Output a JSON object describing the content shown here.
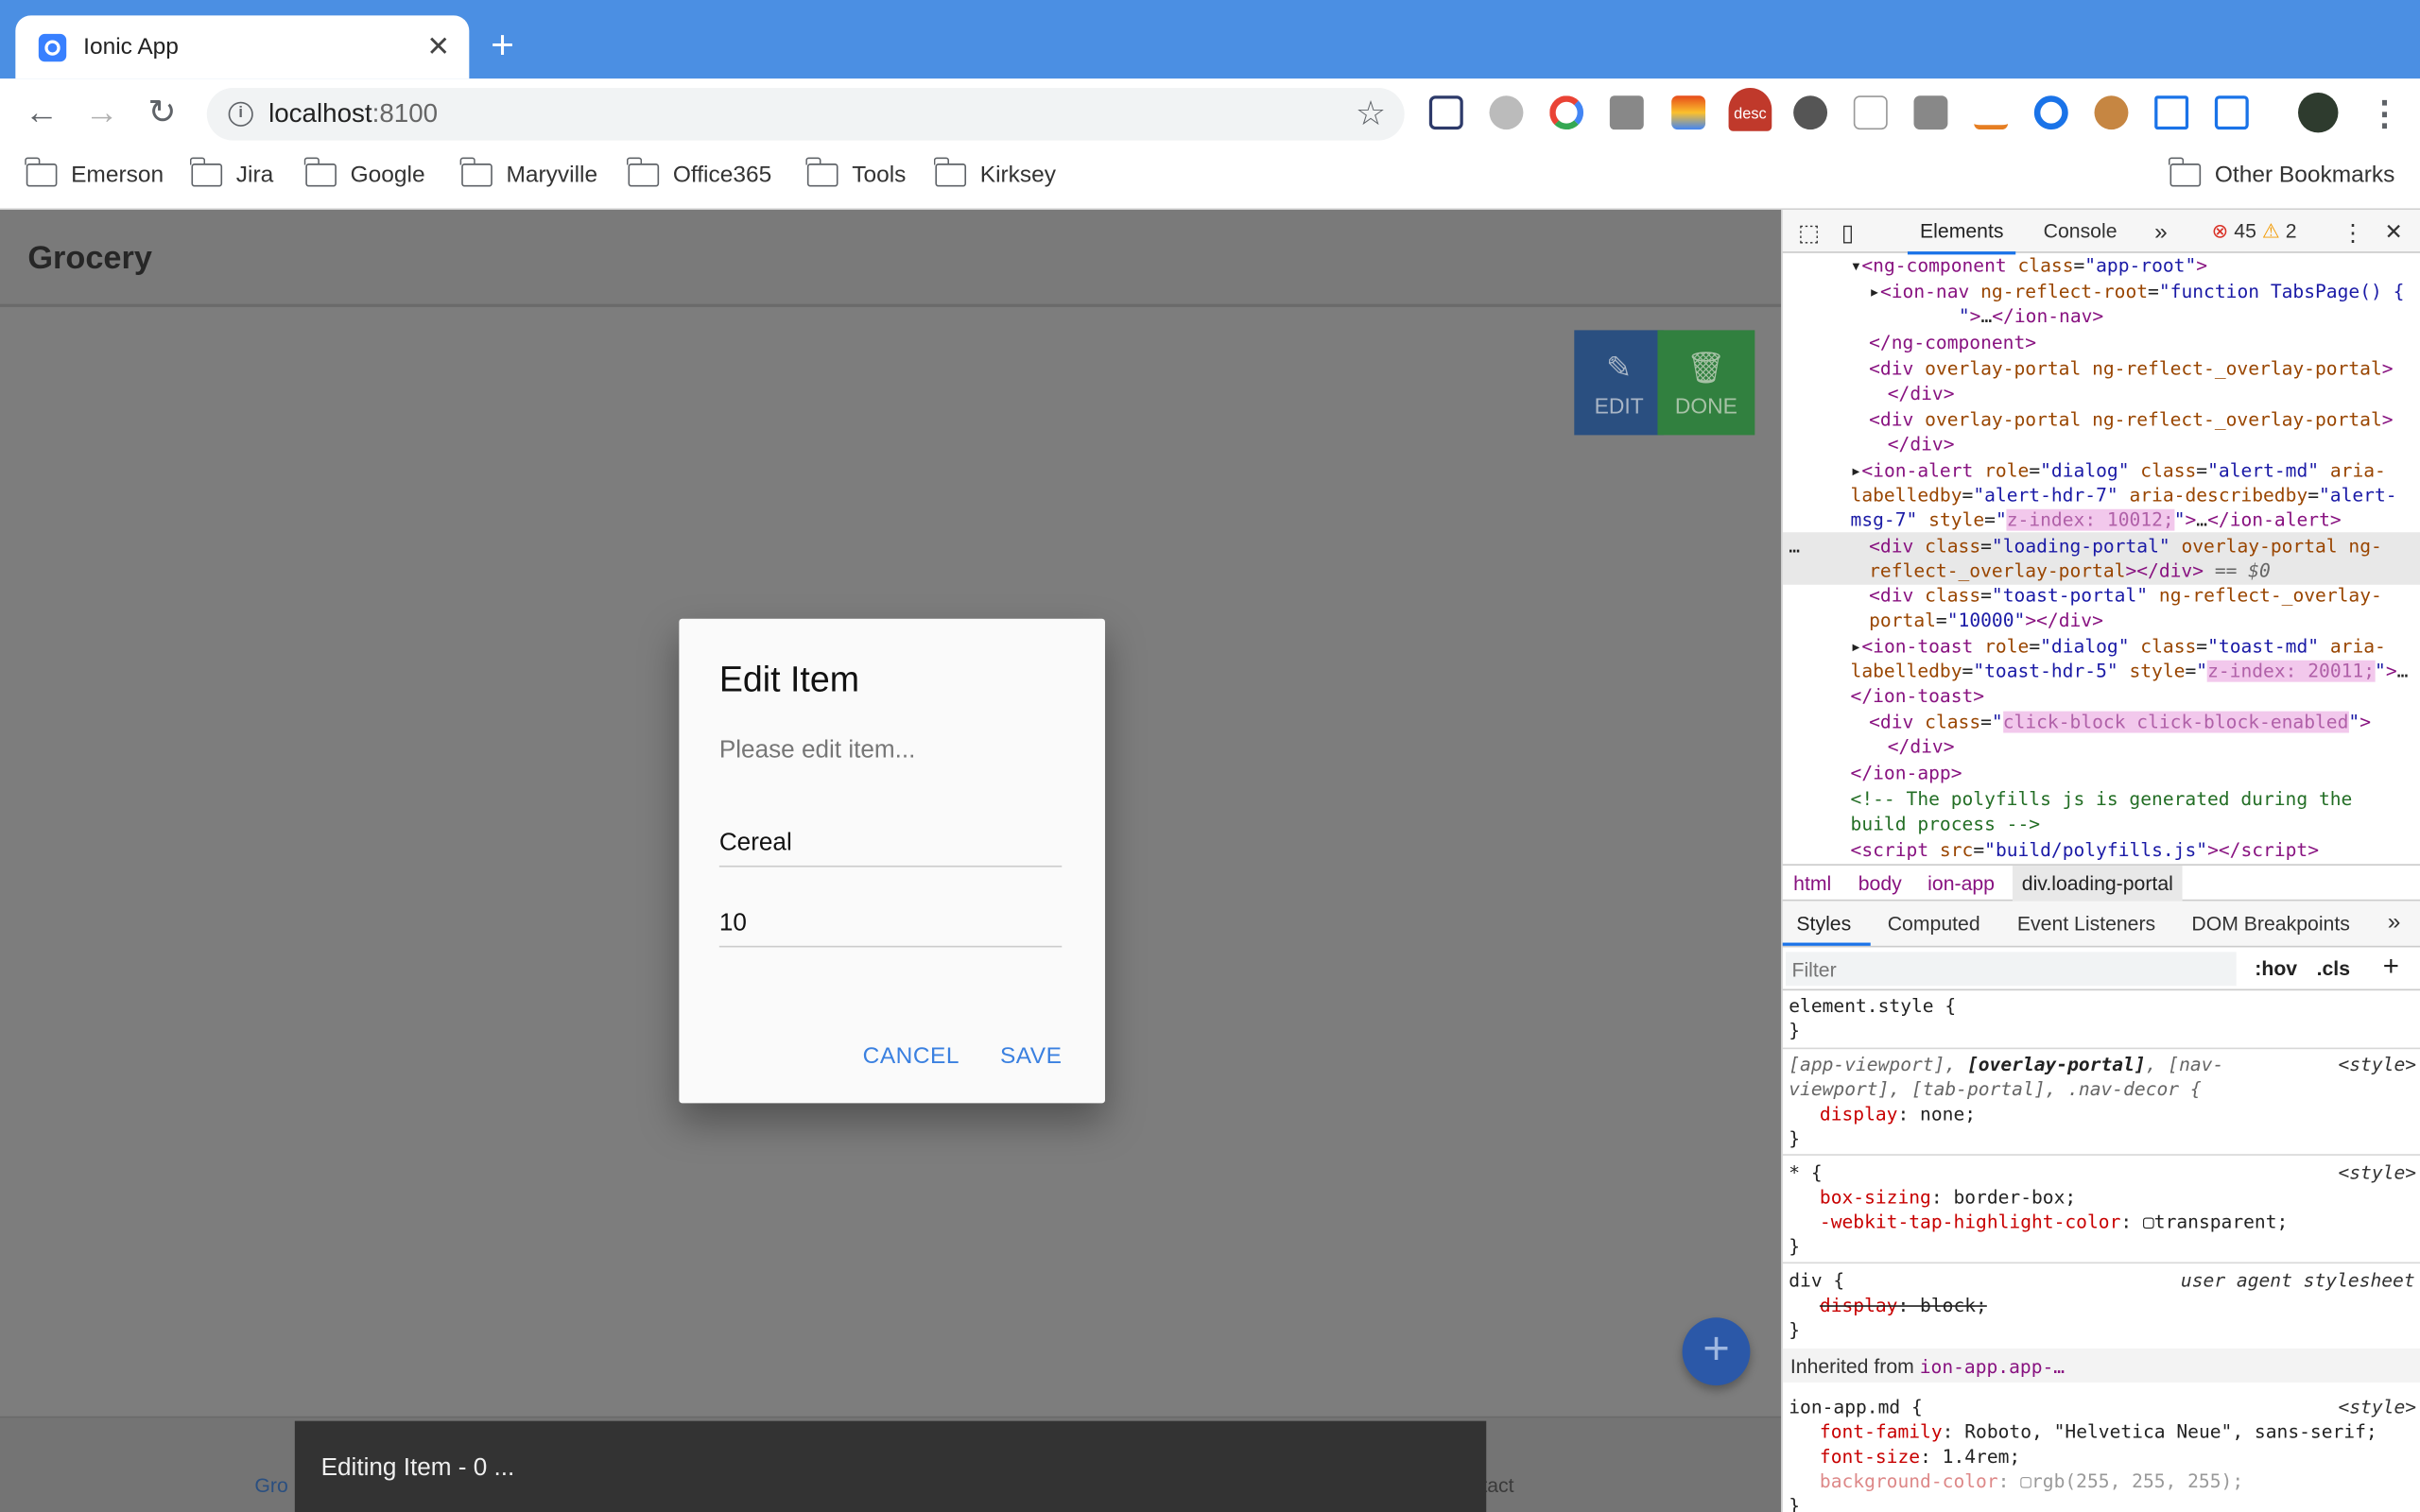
{
  "browser": {
    "tab_title": "Ionic App",
    "tab_close": "✕",
    "new_tab": "+",
    "url_host": "localhost",
    "url_port": ":8100",
    "ext_desc_badge": "desc",
    "bookmarks": [
      "Emerson",
      "Jira",
      "Google",
      "Maryville",
      "Office365",
      "Tools",
      "Kirksey"
    ],
    "other_bookmarks": "Other Bookmarks"
  },
  "app": {
    "title": "Grocery",
    "edit_label": "EDIT",
    "done_label": "DONE",
    "fab": "+",
    "tab_left": "Gro",
    "tab_right": "tact"
  },
  "dialog": {
    "title": "Edit Item",
    "message": "Please edit item...",
    "name_value": "Cereal",
    "quantity_value": "10",
    "cancel": "CANCEL",
    "save": "SAVE"
  },
  "toast": {
    "message": "Editing Item - 0 ..."
  },
  "devtools": {
    "tabs": {
      "elements": "Elements",
      "console": "Console",
      "more": "»"
    },
    "errors": "45",
    "warnings": "2",
    "breadcrumb": [
      "html",
      "body",
      "ion-app",
      "div.loading-portal"
    ],
    "style_tabs": [
      "Styles",
      "Computed",
      "Event Listeners",
      "DOM Breakpoints",
      "»"
    ],
    "filter_placeholder": "Filter",
    "hov": ":hov",
    "cls": ".cls",
    "inherited_prefix": "Inherited from ",
    "inherited_from": "ion-app.app-…"
  }
}
